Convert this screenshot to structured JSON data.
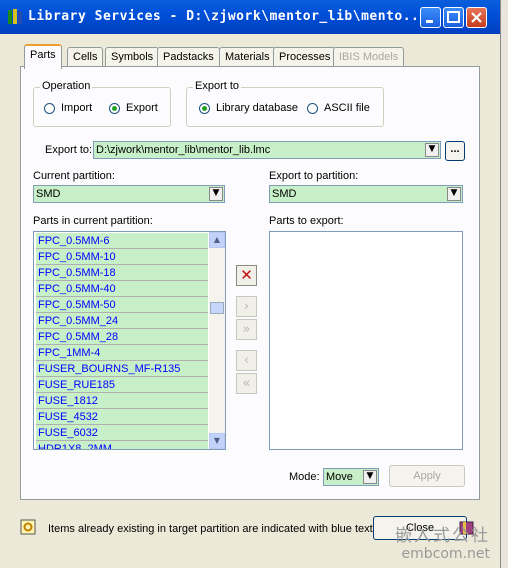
{
  "window": {
    "title": "Library Services - D:\\zjwork\\mentor_lib\\mento...",
    "icons": [
      "app-icon",
      "minimize-icon",
      "maximize-icon",
      "close-icon"
    ]
  },
  "tabs": [
    {
      "label": "Parts",
      "active": true
    },
    {
      "label": "Cells"
    },
    {
      "label": "Symbols"
    },
    {
      "label": "Padstacks"
    },
    {
      "label": "Materials"
    },
    {
      "label": "Processes"
    },
    {
      "label": "IBIS Models",
      "disabled": true
    }
  ],
  "operation": {
    "label": "Operation",
    "import_label": "Import",
    "export_label": "Export",
    "selected": "Export"
  },
  "export_to_group": {
    "label": "Export to",
    "library_label": "Library database",
    "ascii_label": "ASCII file",
    "selected": "Library database"
  },
  "export_path": {
    "label": "Export to:",
    "value": "D:\\zjwork\\mentor_lib\\mentor_lib.lmc",
    "browse_label": "..."
  },
  "current_partition": {
    "label": "Current partition:",
    "value": "SMD"
  },
  "export_partition": {
    "label": "Export to partition:",
    "value": "SMD"
  },
  "parts_list": {
    "label": "Parts in current partition:",
    "items": [
      "FPC_0.5MM-6",
      "FPC_0.5MM-10",
      "FPC_0.5MM-18",
      "FPC_0.5MM-40",
      "FPC_0.5MM-50",
      "FPC_0.5MM_24",
      "FPC_0.5MM_28",
      "FPC_1MM-4",
      "FUSER_BOURNS_MF-R135",
      "FUSE_RUE185",
      "FUSE_1812",
      "FUSE_4532",
      "FUSE_6032",
      "HDR1X8_2MM"
    ]
  },
  "parts_to_export": {
    "label": "Parts to export:"
  },
  "mode": {
    "label": "Mode:",
    "value": "Move"
  },
  "apply_label": "Apply",
  "status": {
    "text": "Items already existing in target partition are indicated with blue text.",
    "close_label": "Close"
  },
  "watermark": {
    "line1": "嵌入式公社",
    "line2": "embcom.net"
  }
}
